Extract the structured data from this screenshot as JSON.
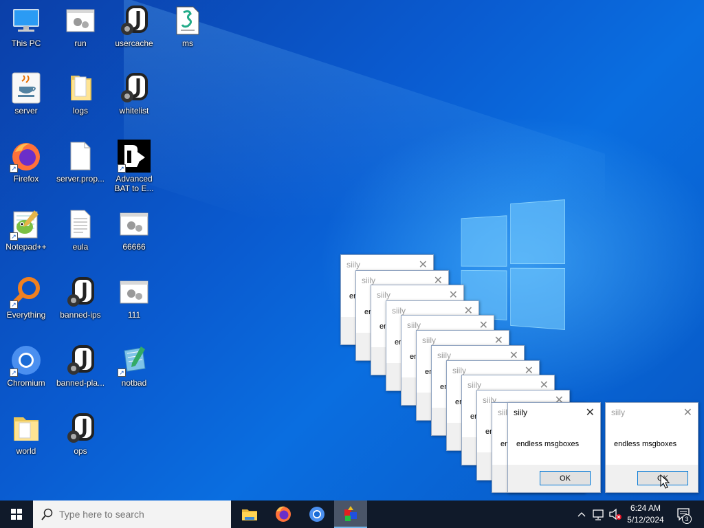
{
  "desktop_icons": [
    {
      "label": "This PC",
      "icon": "this-pc-icon"
    },
    {
      "label": "run",
      "icon": "batch-file-icon"
    },
    {
      "label": "usercache",
      "icon": "json-file-icon"
    },
    {
      "label": "ms",
      "icon": "script-file-icon"
    },
    {
      "label": "server",
      "icon": "java-icon"
    },
    {
      "label": "logs",
      "icon": "folder-icon"
    },
    {
      "label": "whitelist",
      "icon": "json-file-icon"
    },
    {
      "label": "Firefox",
      "icon": "firefox-icon"
    },
    {
      "label": "server.prop...",
      "icon": "blank-file-icon"
    },
    {
      "label": "Advanced BAT to E...",
      "icon": "bat-to-exe-icon"
    },
    {
      "label": "Notepad++",
      "icon": "notepadpp-icon"
    },
    {
      "label": "eula",
      "icon": "text-file-icon"
    },
    {
      "label": "66666",
      "icon": "batch-file-icon"
    },
    {
      "label": "Everything",
      "icon": "everything-search-icon"
    },
    {
      "label": "banned-ips",
      "icon": "json-file-icon"
    },
    {
      "label": "111",
      "icon": "batch-file-icon"
    },
    {
      "label": "Chromium",
      "icon": "chromium-icon"
    },
    {
      "label": "banned-pla...",
      "icon": "json-file-icon"
    },
    {
      "label": "notbad",
      "icon": "notepad-icon"
    },
    {
      "label": "world",
      "icon": "folder-icon"
    },
    {
      "label": "ops",
      "icon": "json-file-icon"
    }
  ],
  "msgbox": {
    "title": "siily",
    "message": "endless msgboxes",
    "ok_label": "OK",
    "stack_partial_text": "en"
  },
  "taskbar": {
    "search_placeholder": "Type here to search",
    "apps": [
      "file-explorer-icon",
      "firefox-icon",
      "chromium-icon",
      "running-app-icon"
    ],
    "clock_time": "6:24 AM",
    "clock_date": "5/12/2024",
    "notification_count": "3"
  },
  "colors": {
    "accent": "#0078d7",
    "taskbar": "#101a2a"
  }
}
